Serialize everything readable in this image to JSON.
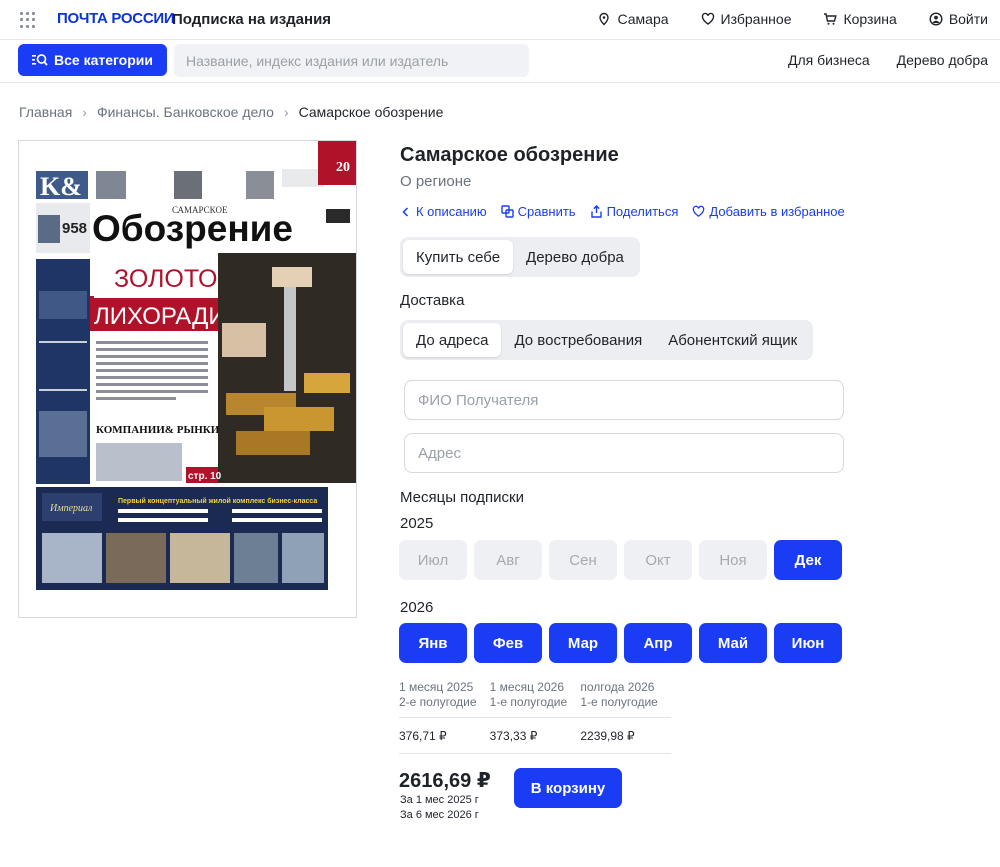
{
  "header": {
    "logo": "ПОЧТА РОССИИ",
    "service": "Подписка на издания",
    "nav": [
      {
        "label": "Самара",
        "icon": "location-icon"
      },
      {
        "label": "Избранное",
        "icon": "heart-icon"
      },
      {
        "label": "Корзина",
        "icon": "cart-icon"
      },
      {
        "label": "Войти",
        "icon": "user-icon"
      }
    ]
  },
  "subbar": {
    "categories_label": "Все категории",
    "search_placeholder": "Название, индекс издания или издатель",
    "links": [
      "Для бизнеса",
      "Дерево добра"
    ]
  },
  "breadcrumb": [
    "Главная",
    "Финансы. Банковское дело",
    "Самарское обозрение"
  ],
  "cover": {
    "masthead_small": "САМАРСКОЕ",
    "masthead": "Обозрение",
    "headline_1": "ЗОЛОТО",
    "headline_2": "ЛИХОРАДИТ",
    "section": "КОМПАНИИ& РЫНКИ",
    "page_ref": "стр. 10",
    "ad_title": "Первый концептуальный жилой комплекс бизнес-класса",
    "ad_brand": "Империал",
    "number": "958"
  },
  "product": {
    "title": "Самарское обозрение",
    "subtitle": "О регионе",
    "actions": [
      "К описанию",
      "Сравнить",
      "Поделиться",
      "Добавить в избранное"
    ],
    "buy_options": [
      "Купить себе",
      "Дерево добра"
    ],
    "delivery_label": "Доставка",
    "delivery_options": [
      "До адреса",
      "До востребования",
      "Абонентский ящик"
    ],
    "recipient_placeholder": "ФИО Получателя",
    "address_placeholder": "Адрес",
    "months_label": "Месяцы подписки",
    "year_2025": "2025",
    "months_2025": [
      {
        "label": "Июл",
        "state": "disabled"
      },
      {
        "label": "Авг",
        "state": "disabled"
      },
      {
        "label": "Сен",
        "state": "disabled"
      },
      {
        "label": "Окт",
        "state": "disabled"
      },
      {
        "label": "Ноя",
        "state": "disabled"
      },
      {
        "label": "Дек",
        "state": "selected"
      }
    ],
    "year_2026": "2026",
    "months_2026": [
      {
        "label": "Янв",
        "state": "selected"
      },
      {
        "label": "Фев",
        "state": "selected"
      },
      {
        "label": "Мар",
        "state": "selected"
      },
      {
        "label": "Апр",
        "state": "selected"
      },
      {
        "label": "Май",
        "state": "selected"
      },
      {
        "label": "Июн",
        "state": "selected"
      }
    ],
    "price_table": [
      {
        "line1": "1 месяц 2025",
        "line2": "2-е полугодие",
        "price": "376,71 ₽"
      },
      {
        "line1": "1 месяц 2026",
        "line2": "1-е полугодие",
        "price": "373,33 ₽"
      },
      {
        "line1": "полгода 2026",
        "line2": "1-е полугодие",
        "price": "2239,98 ₽"
      }
    ],
    "total": "2616,69 ₽",
    "total_note_1": "За 1 мес 2025 г",
    "total_note_2": "За 6 мес 2026 г",
    "cart_button": "В корзину"
  },
  "colors": {
    "accent": "#1b3cf5",
    "logo": "#0b33d6",
    "cover_red": "#b0122a",
    "cover_navy": "#1e3566"
  }
}
